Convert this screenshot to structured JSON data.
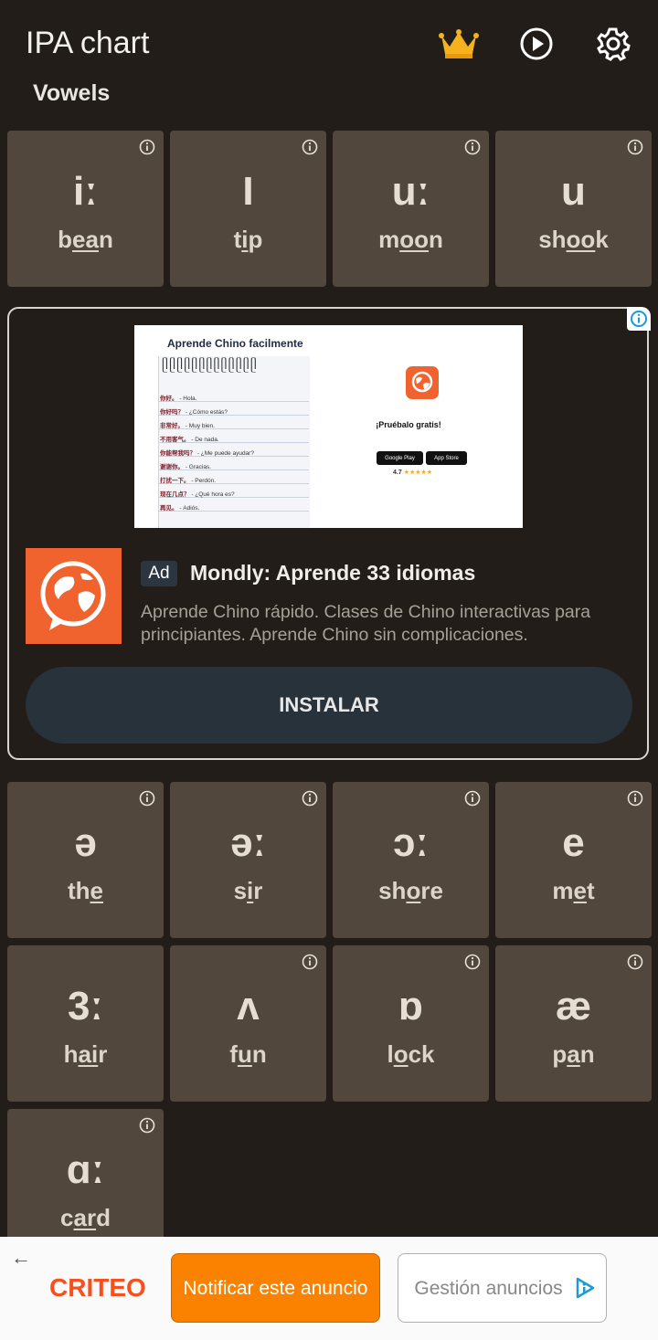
{
  "appbar": {
    "title": "IPA chart"
  },
  "section": {
    "title": "Vowels"
  },
  "row1": [
    {
      "symbol": "iː",
      "w_pre": "b",
      "w_u": "ea",
      "w_post": "n"
    },
    {
      "symbol": "I",
      "w_pre": "t",
      "w_u": "i",
      "w_post": "p"
    },
    {
      "symbol": "uː",
      "w_pre": "m",
      "w_u": "oo",
      "w_post": "n"
    },
    {
      "symbol": "u",
      "w_pre": "sh",
      "w_u": "oo",
      "w_post": "k"
    }
  ],
  "row2": [
    {
      "symbol": "ə",
      "w_pre": "th",
      "w_u": "e",
      "w_post": ""
    },
    {
      "symbol": "əː",
      "w_pre": "s",
      "w_u": "i",
      "w_post": "r"
    },
    {
      "symbol": "ɔː",
      "w_pre": "sh",
      "w_u": "o",
      "w_post": "re"
    },
    {
      "symbol": "e",
      "w_pre": "m",
      "w_u": "e",
      "w_post": "t"
    }
  ],
  "row3": [
    {
      "symbol": "3ː",
      "w_pre": "h",
      "w_u": "ai",
      "w_post": "r"
    },
    {
      "symbol": "ʌ",
      "w_pre": "f",
      "w_u": "u",
      "w_post": "n"
    },
    {
      "symbol": "ɒ",
      "w_pre": "l",
      "w_u": "o",
      "w_post": "ck"
    },
    {
      "symbol": "æ",
      "w_pre": "p",
      "w_u": "a",
      "w_post": "n"
    }
  ],
  "row4": [
    {
      "symbol": "ɑː",
      "w_pre": "c",
      "w_u": "ar",
      "w_post": "d"
    }
  ],
  "ad": {
    "creative_heading": "Aprende Chino facilmente",
    "notebook_lines": [
      {
        "zh": "你好。",
        "es": "- Hola."
      },
      {
        "zh": "你好吗？",
        "es": "- ¿Cómo estás?"
      },
      {
        "zh": "非常好。",
        "es": "- Muy bien."
      },
      {
        "zh": "不用客气。",
        "es": "- De nada."
      },
      {
        "zh": "你能帮我吗？",
        "es": "- ¿Me puede ayudar?"
      },
      {
        "zh": "谢谢你。",
        "es": "- Gracias."
      },
      {
        "zh": "打扰一下。",
        "es": "- Perdón."
      },
      {
        "zh": "现在几点？",
        "es": "- ¿Qué hora es?"
      },
      {
        "zh": "再见。",
        "es": "- Adiós."
      }
    ],
    "try_text": "¡Pruébalo gratis!",
    "store_google": "Google Play",
    "store_apple": "App Store",
    "rating_value": "4.7",
    "rating_stars": "★★★★★",
    "badge": "Ad",
    "title": "Mondly: Aprende 33 idiomas",
    "description": "Aprende Chino rápido. Clases de Chino interactivas para principiantes. Aprende Chino sin complicaciones.",
    "cta": "INSTALAR"
  },
  "bottom": {
    "brand": "CRITEO",
    "notify": "Notificar este anuncio",
    "manage": "Gestión anuncios"
  },
  "colors": {
    "background": "#221d18",
    "tile": "#51473d",
    "criteo_orange": "#fb8200",
    "mondly": "#f0632e"
  }
}
